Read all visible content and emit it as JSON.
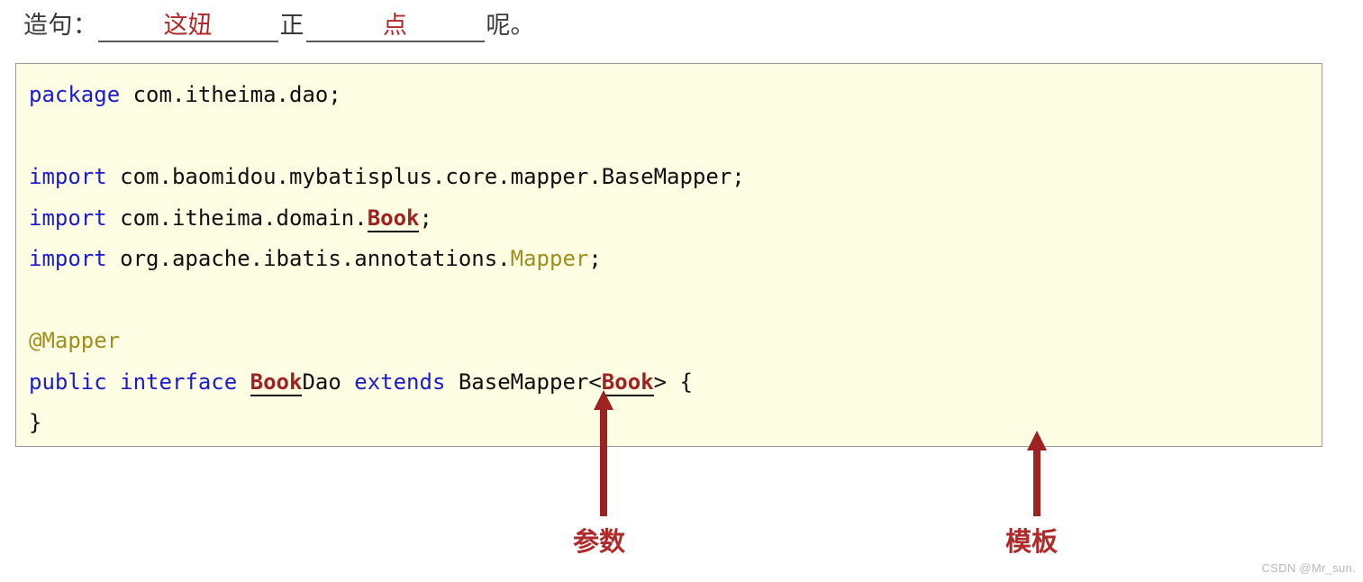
{
  "header": {
    "lead": "造句：",
    "blank1": "这妞",
    "mid": "正",
    "blank2": "点",
    "tail": "呢。"
  },
  "code": {
    "language": "java",
    "lines": [
      {
        "id": "line-package",
        "tokens": [
          {
            "text": "package",
            "style": "kw"
          },
          {
            "text": " com.itheima.dao;",
            "style": "plain"
          }
        ]
      },
      {
        "id": "line-blank-1",
        "tokens": [
          {
            "text": " ",
            "style": "plain"
          }
        ]
      },
      {
        "id": "line-import-basemapper",
        "tokens": [
          {
            "text": "import",
            "style": "kw"
          },
          {
            "text": " com.baomidou.mybatisplus.core.mapper.BaseMapper;",
            "style": "plain"
          }
        ]
      },
      {
        "id": "line-import-book",
        "tokens": [
          {
            "text": "import",
            "style": "kw"
          },
          {
            "text": " com.itheima.domain.",
            "style": "plain"
          },
          {
            "text": "Book",
            "style": "cls"
          },
          {
            "text": ";",
            "style": "plain"
          }
        ]
      },
      {
        "id": "line-import-mapper",
        "tokens": [
          {
            "text": "import",
            "style": "kw"
          },
          {
            "text": " org.apache.ibatis.annotations.",
            "style": "plain"
          },
          {
            "text": "Mapper",
            "style": "type"
          },
          {
            "text": ";",
            "style": "plain"
          }
        ]
      },
      {
        "id": "line-blank-2",
        "tokens": [
          {
            "text": " ",
            "style": "plain"
          }
        ]
      },
      {
        "id": "line-annotation-mapper",
        "tokens": [
          {
            "text": "@Mapper",
            "style": "anno"
          }
        ]
      },
      {
        "id": "line-interface-decl",
        "tokens": [
          {
            "text": "public",
            "style": "kw"
          },
          {
            "text": " ",
            "style": "plain"
          },
          {
            "text": "interface",
            "style": "kw"
          },
          {
            "text": " ",
            "style": "plain"
          },
          {
            "text": "Book",
            "style": "cls"
          },
          {
            "text": "Dao ",
            "style": "plain"
          },
          {
            "text": "extends",
            "style": "kw"
          },
          {
            "text": " BaseMapper<",
            "style": "plain"
          },
          {
            "text": "Book",
            "style": "cls"
          },
          {
            "text": "> {",
            "style": "plain"
          }
        ]
      },
      {
        "id": "line-close-brace",
        "tokens": [
          {
            "text": "}",
            "style": "plain"
          }
        ]
      }
    ]
  },
  "annotations": [
    {
      "id": "param",
      "label": "参数"
    },
    {
      "id": "template",
      "label": "模板"
    }
  ],
  "watermark": "CSDN @Mr_sun.",
  "colors": {
    "accent_red": "#b02a2a",
    "keyword_blue": "#1b1bcf",
    "annotation_gold": "#a08f1e",
    "class_red": "#9e2222",
    "code_bg": "#fdfde4",
    "code_border": "#9a9a96"
  }
}
